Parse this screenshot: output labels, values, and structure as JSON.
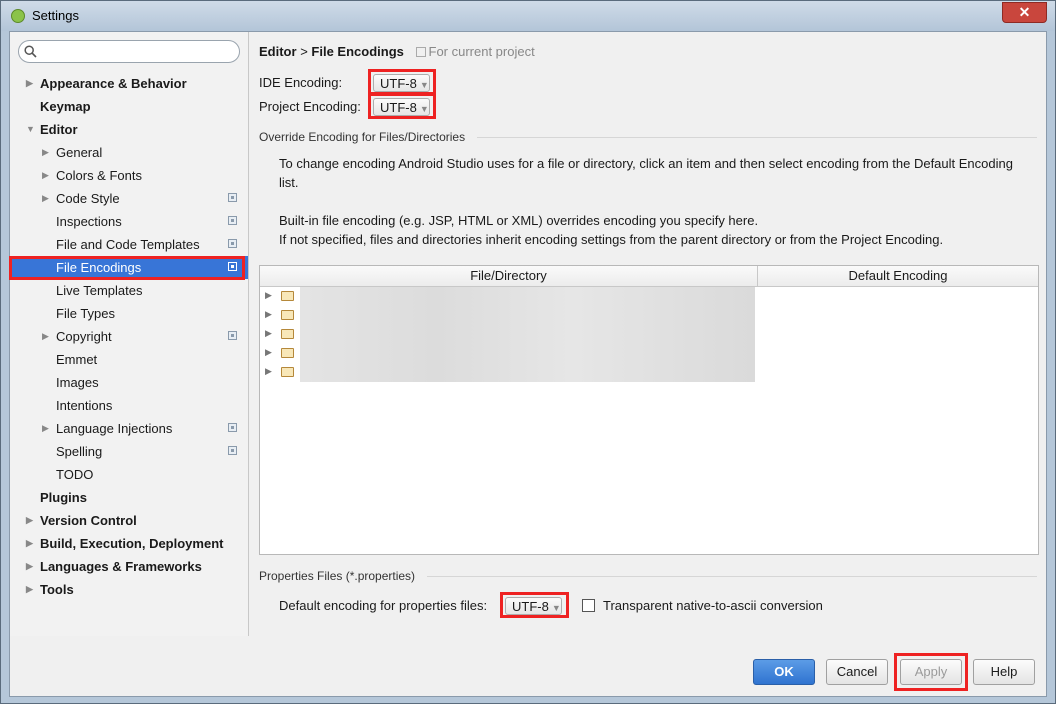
{
  "window": {
    "title": "Settings",
    "close_glyph": "✕"
  },
  "search": {
    "placeholder": ""
  },
  "sidebar": {
    "items": [
      {
        "label": "Appearance & Behavior",
        "bold": true,
        "arrow": "▶",
        "indent": 0
      },
      {
        "label": "Keymap",
        "bold": true,
        "arrow": "",
        "indent": 0
      },
      {
        "label": "Editor",
        "bold": true,
        "arrow": "▼",
        "indent": 0
      },
      {
        "label": "General",
        "arrow": "▶",
        "indent": 1
      },
      {
        "label": "Colors & Fonts",
        "arrow": "▶",
        "indent": 1
      },
      {
        "label": "Code Style",
        "arrow": "▶",
        "indent": 1,
        "project": true
      },
      {
        "label": "Inspections",
        "arrow": "",
        "indent": 1,
        "project": true
      },
      {
        "label": "File and Code Templates",
        "arrow": "",
        "indent": 1,
        "project": true
      },
      {
        "label": "File Encodings",
        "arrow": "",
        "indent": 1,
        "project": true,
        "selected": true
      },
      {
        "label": "Live Templates",
        "arrow": "",
        "indent": 1
      },
      {
        "label": "File Types",
        "arrow": "",
        "indent": 1
      },
      {
        "label": "Copyright",
        "arrow": "▶",
        "indent": 1,
        "project": true
      },
      {
        "label": "Emmet",
        "arrow": "",
        "indent": 1
      },
      {
        "label": "Images",
        "arrow": "",
        "indent": 1
      },
      {
        "label": "Intentions",
        "arrow": "",
        "indent": 1
      },
      {
        "label": "Language Injections",
        "arrow": "▶",
        "indent": 1,
        "project": true
      },
      {
        "label": "Spelling",
        "arrow": "",
        "indent": 1,
        "project": true
      },
      {
        "label": "TODO",
        "arrow": "",
        "indent": 1
      },
      {
        "label": "Plugins",
        "bold": true,
        "arrow": "",
        "indent": 0
      },
      {
        "label": "Version Control",
        "bold": true,
        "arrow": "▶",
        "indent": 0
      },
      {
        "label": "Build, Execution, Deployment",
        "bold": true,
        "arrow": "▶",
        "indent": 0
      },
      {
        "label": "Languages & Frameworks",
        "bold": true,
        "arrow": "▶",
        "indent": 0
      },
      {
        "label": "Tools",
        "bold": true,
        "arrow": "▶",
        "indent": 0
      }
    ]
  },
  "breadcrumb": {
    "parent": "Editor",
    "separator": ">",
    "current": "File Encodings",
    "scope": "For current project"
  },
  "ide_encoding": {
    "label": "IDE Encoding:",
    "value": "UTF-8"
  },
  "project_encoding": {
    "label": "Project Encoding:",
    "value": "UTF-8"
  },
  "override_section": {
    "title": "Override Encoding for Files/Directories",
    "para1": "To change encoding Android Studio uses for a file or directory, click an item and then select encoding from the Default Encoding list.",
    "para2_line1": "Built-in file encoding (e.g. JSP, HTML or XML) overrides encoding you specify here.",
    "para2_line2": "If not specified, files and directories inherit encoding settings from the parent directory or from the Project Encoding."
  },
  "table": {
    "headers": [
      "File/Directory",
      "Default Encoding"
    ],
    "row_count": 5
  },
  "properties_section": {
    "title": "Properties Files (*.properties)",
    "default_label": "Default encoding for properties files:",
    "default_value": "UTF-8",
    "transparent_label": "Transparent native-to-ascii conversion",
    "transparent_checked": false
  },
  "buttons": {
    "ok": "OK",
    "cancel": "Cancel",
    "apply": "Apply",
    "help": "Help"
  },
  "colors": {
    "selection": "#3875d7",
    "highlight": "#ee2222",
    "ok_button": "#2f73d0"
  }
}
